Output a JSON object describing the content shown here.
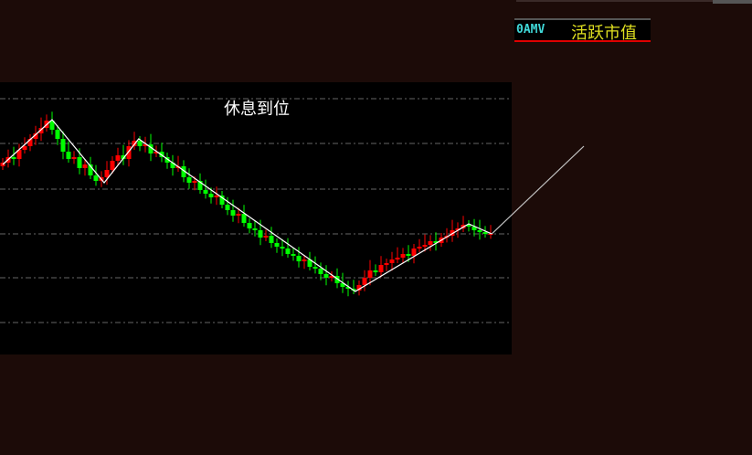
{
  "badge": {
    "code": "0AMV",
    "name": "活跃市值"
  },
  "chart_data": {
    "type": "candlestick",
    "title": "休息到位",
    "ylim": [
      10.1,
      25
    ],
    "gridlines": [
      24.1,
      21.65,
      19.15,
      16.7,
      14.3,
      11.85
    ],
    "closes": [
      20.6,
      20.9,
      20.8,
      21.3,
      21.5,
      21.9,
      22.2,
      22.5,
      22.9,
      22.4,
      21.9,
      21.2,
      20.8,
      20.9,
      20.3,
      20.5,
      19.9,
      19.6,
      19.8,
      20.2,
      20.7,
      21.0,
      20.8,
      21.5,
      21.8,
      21.5,
      21.6,
      21.1,
      21.2,
      20.9,
      20.6,
      20.3,
      20.4,
      19.8,
      19.5,
      19.6,
      19.1,
      18.9,
      18.7,
      18.8,
      18.3,
      18.0,
      17.7,
      17.8,
      17.3,
      17.0,
      16.9,
      16.5,
      16.6,
      16.2,
      16.0,
      15.9,
      15.6,
      15.5,
      15.2,
      15.3,
      14.9,
      14.8,
      14.5,
      14.3,
      14.4,
      14.0,
      13.8,
      13.7,
      13.6,
      13.9,
      14.3,
      14.7,
      14.6,
      15.0,
      15.1,
      15.3,
      15.4,
      15.6,
      15.5,
      15.9,
      16.0,
      16.1,
      16.3,
      16.2,
      16.5,
      16.6,
      16.9,
      17.0,
      17.2,
      17.1,
      16.9,
      16.8,
      16.7,
      16.7
    ],
    "zigzag": [
      [
        0,
        20.5
      ],
      [
        9,
        22.95
      ],
      [
        18.5,
        19.5
      ],
      [
        24.8,
        21.9
      ],
      [
        64.3,
        13.55
      ],
      [
        85,
        17.25
      ],
      [
        89.2,
        16.7
      ]
    ],
    "projection": [
      [
        89.2,
        16.7
      ],
      [
        106,
        21.5
      ]
    ],
    "colors": {
      "up": "#ff0000",
      "down": "#00ff00",
      "zigzag": "#ffffff",
      "projection": "#c0c0c0",
      "grid": "#666666",
      "panel": "#000000"
    }
  }
}
